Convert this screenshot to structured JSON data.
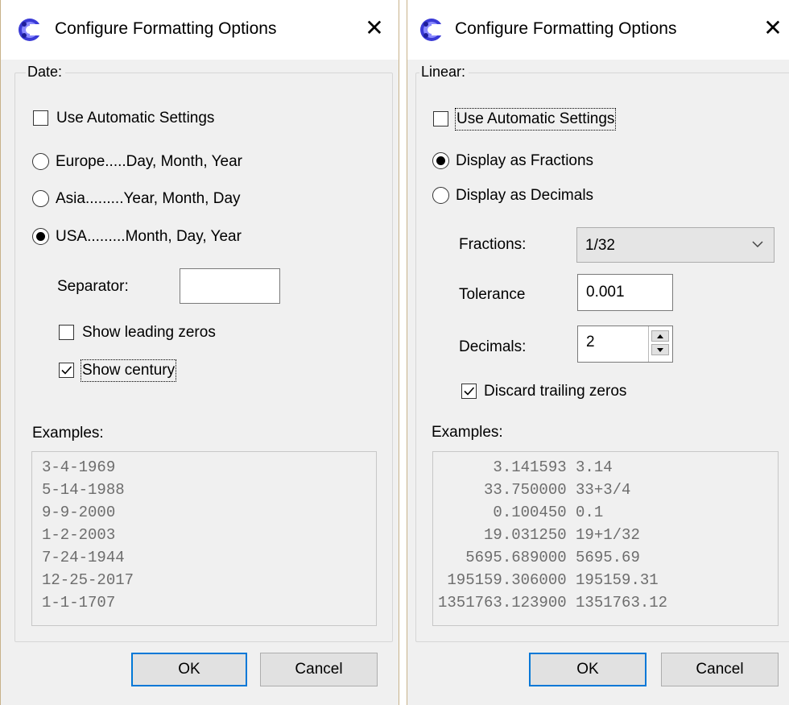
{
  "colors": {
    "accent": "#0078d7",
    "dialog_bg": "#f0f0f0",
    "example_text": "#6d6d6d"
  },
  "left_dialog": {
    "title": "Configure Formatting Options",
    "close_icon": "close-icon",
    "group_label": "Date:",
    "use_automatic": {
      "label": "Use Automatic Settings",
      "checked": false
    },
    "formats": [
      {
        "label": "Europe.....Day, Month, Year",
        "selected": false
      },
      {
        "label": "Asia.........Year, Month, Day",
        "selected": false
      },
      {
        "label": "USA.........Month, Day, Year",
        "selected": true
      }
    ],
    "separator_label": "Separator:",
    "separator_value": "",
    "show_leading_zeros": {
      "label": "Show leading zeros",
      "checked": false
    },
    "show_century": {
      "label": "Show century",
      "checked": true
    },
    "examples_label": "Examples:",
    "examples": [
      "3-4-1969",
      "5-14-1988",
      "9-9-2000",
      "1-2-2003",
      "7-24-1944",
      "12-25-2017",
      "1-1-1707"
    ],
    "ok_label": "OK",
    "cancel_label": "Cancel"
  },
  "right_dialog": {
    "title": "Configure Formatting Options",
    "close_icon": "close-icon",
    "group_label": "Linear:",
    "use_automatic": {
      "label": "Use Automatic Settings",
      "checked": false
    },
    "display_fractions": {
      "label": "Display as Fractions",
      "selected": true
    },
    "display_decimals": {
      "label": "Display as Decimals",
      "selected": false
    },
    "fractions_label": "Fractions:",
    "fractions_value": "1/32",
    "tolerance_label": "Tolerance",
    "tolerance_value": "0.001",
    "decimals_label": "Decimals:",
    "decimals_value": "2",
    "discard_trailing_zeros": {
      "label": "Discard trailing zeros",
      "checked": true
    },
    "examples_label": "Examples:",
    "examples": [
      "      3.141593 3.14",
      "     33.750000 33+3/4",
      "      0.100450 0.1",
      "     19.031250 19+1/32",
      "   5695.689000 5695.69",
      " 195159.306000 195159.31",
      "1351763.123900 1351763.12"
    ],
    "ok_label": "OK",
    "cancel_label": "Cancel"
  }
}
